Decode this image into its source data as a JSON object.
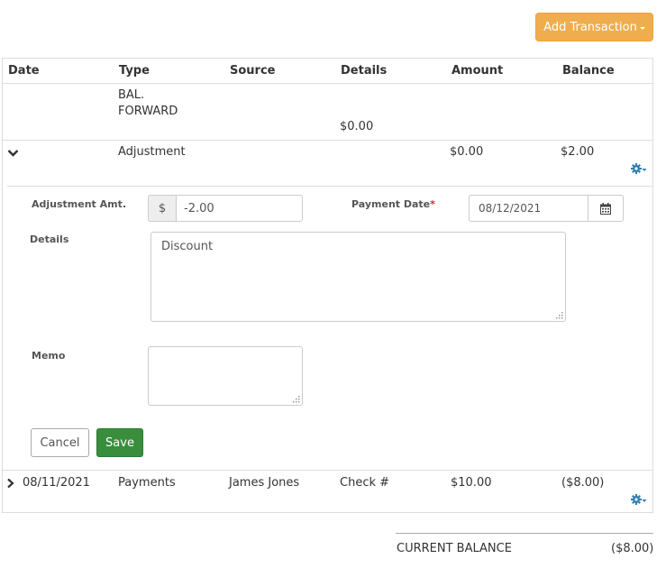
{
  "toolbar": {
    "add_transaction_label": "Add Transaction"
  },
  "table": {
    "headers": [
      "Date",
      "Type",
      "Source",
      "Details",
      "Amount",
      "Balance"
    ],
    "bal_forward": {
      "type_line1": "BAL.",
      "type_line2": "FORWARD",
      "details": "$0.00"
    },
    "expanded_row": {
      "date": "",
      "type": "Adjustment",
      "source": "",
      "details": "",
      "amount": "$0.00",
      "balance": "$2.00"
    },
    "payment_row": {
      "date": "08/11/2021",
      "type": "Payments",
      "source": "James Jones",
      "details": "Check #",
      "amount": "$10.00",
      "balance": "($8.00)"
    }
  },
  "form": {
    "adjustment_label": "Adjustment Amt.",
    "currency_symbol": "$",
    "adjustment_value": "-2.00",
    "payment_date_label": "Payment Date",
    "required_mark": "*",
    "payment_date_value": "08/12/2021",
    "details_label": "Details",
    "details_value": "Discount",
    "memo_label": "Memo",
    "memo_value": "",
    "cancel_label": "Cancel",
    "save_label": "Save"
  },
  "summary": {
    "label": "CURRENT BALANCE",
    "value": "($8.00)"
  },
  "colors": {
    "accent": "#f0ad4e",
    "save": "#388e3c",
    "gear": "#2f7fb0"
  },
  "icons": [
    "chevron-down-icon",
    "chevron-right-icon",
    "gear-icon",
    "calendar-icon"
  ]
}
